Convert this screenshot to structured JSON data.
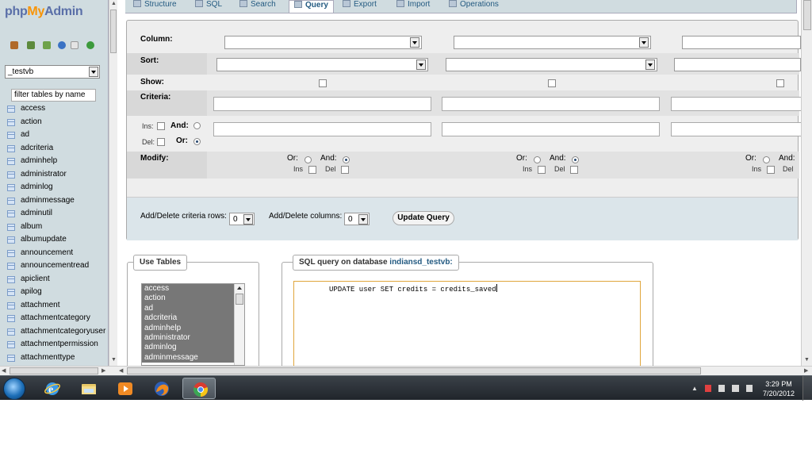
{
  "app": {
    "logo_part1": "php",
    "logo_part2": "My",
    "logo_part3": "Admin"
  },
  "left_panel": {
    "database": "_testvb",
    "filter_placeholder": "filter tables by name",
    "tables": [
      "access",
      "action",
      "ad",
      "adcriteria",
      "adminhelp",
      "administrator",
      "adminlog",
      "adminmessage",
      "adminutil",
      "album",
      "albumupdate",
      "announcement",
      "announcementread",
      "apiclient",
      "apilog",
      "attachment",
      "attachmentcategory",
      "attachmentcategoryuser",
      "attachmentpermission",
      "attachmenttype"
    ]
  },
  "tabs": [
    {
      "label": "Structure",
      "icon": "structure-icon"
    },
    {
      "label": "SQL",
      "icon": "sql-icon"
    },
    {
      "label": "Search",
      "icon": "search-icon"
    },
    {
      "label": "Query",
      "icon": "query-icon",
      "active": true
    },
    {
      "label": "Export",
      "icon": "export-icon"
    },
    {
      "label": "Import",
      "icon": "import-icon"
    },
    {
      "label": "Operations",
      "icon": "operations-icon"
    }
  ],
  "query_form": {
    "column_label": "Column:",
    "sort_label": "Sort:",
    "show_label": "Show:",
    "criteria_label": "Criteria:",
    "ins_label": "Ins:",
    "del_label": "Del:",
    "and_label": "And:",
    "or_label": "Or:",
    "modify_label": "Modify:",
    "mod_or": "Or:",
    "mod_and": "And:",
    "mod_ins": "Ins",
    "mod_del": "Del",
    "criteria_rows_label": "Add/Delete criteria rows:",
    "criteria_rows_value": "0",
    "columns_label": "Add/Delete columns:",
    "columns_value": "0",
    "update_button": "Update Query"
  },
  "use_tables": {
    "legend": "Use Tables",
    "items": [
      "access",
      "action",
      "ad",
      "adcriteria",
      "adminhelp",
      "administrator",
      "adminlog",
      "adminmessage"
    ]
  },
  "sql_query": {
    "legend_prefix": "SQL query on database",
    "database": "indiansd_testvb:",
    "text": "UPDATE user SET credits = credits_saved"
  },
  "taskbar": {
    "time": "3:29 PM",
    "date": "7/20/2012",
    "apps": [
      "internet-explorer",
      "windows-explorer",
      "media-player",
      "firefox",
      "chrome"
    ],
    "active_app": "chrome"
  }
}
